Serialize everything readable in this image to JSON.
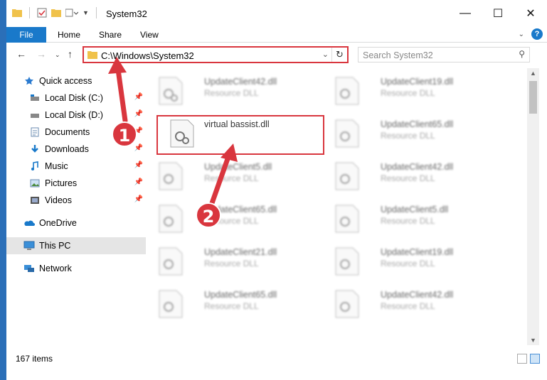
{
  "window": {
    "title": "System32",
    "controls": {
      "minimize": "—",
      "maximize": "☐",
      "close": "✕"
    }
  },
  "ribbon": {
    "tabs": [
      {
        "label": "File"
      },
      {
        "label": "Home"
      },
      {
        "label": "Share"
      },
      {
        "label": "View"
      }
    ],
    "help": "?"
  },
  "nav": {
    "address": "C:\\Windows\\System32",
    "search_placeholder": "Search System32"
  },
  "sidebar": {
    "items": [
      {
        "label": "Quick access",
        "icon": "star-icon",
        "pinned": false
      },
      {
        "label": "Local Disk (C:)",
        "icon": "drive-icon",
        "pinned": true
      },
      {
        "label": "Local Disk (D:)",
        "icon": "drive-icon",
        "pinned": true
      },
      {
        "label": "Documents",
        "icon": "documents-icon",
        "pinned": true
      },
      {
        "label": "Downloads",
        "icon": "downloads-icon",
        "pinned": true
      },
      {
        "label": "Music",
        "icon": "music-icon",
        "pinned": true
      },
      {
        "label": "Pictures",
        "icon": "pictures-icon",
        "pinned": true
      },
      {
        "label": "Videos",
        "icon": "videos-icon",
        "pinned": true
      },
      {
        "label": "OneDrive",
        "icon": "onedrive-icon",
        "pinned": false
      },
      {
        "label": "This PC",
        "icon": "pc-icon",
        "pinned": false,
        "selected": true
      },
      {
        "label": "Network",
        "icon": "network-icon",
        "pinned": false
      }
    ]
  },
  "files": {
    "left": [
      {
        "name": "UpdateClient42.dll",
        "type": "Resource DLL"
      },
      {
        "name": "virtual bassist.dll",
        "type": ""
      },
      {
        "name": "UpdateClient5.dll",
        "type": "Resource DLL"
      },
      {
        "name": "UpdateClient65.dll",
        "type": "Resource DLL"
      },
      {
        "name": "UpdateClient21.dll",
        "type": "Resource DLL"
      },
      {
        "name": "UpdateClient65.dll",
        "type": "Resource DLL"
      }
    ],
    "right": [
      {
        "name": "UpdateClient19.dll",
        "type": "Resource DLL"
      },
      {
        "name": "UpdateClient65.dll",
        "type": "Resource DLL"
      },
      {
        "name": "UpdateClient42.dll",
        "type": "Resource DLL"
      },
      {
        "name": "UpdateClient5.dll",
        "type": "Resource DLL"
      },
      {
        "name": "UpdateClient19.dll",
        "type": "Resource DLL"
      },
      {
        "name": "UpdateClient42.dll",
        "type": "Resource DLL"
      }
    ]
  },
  "status": {
    "item_count": "167 items"
  },
  "annotations": {
    "step1": "1",
    "step2": "2",
    "color": "#d9363e"
  }
}
